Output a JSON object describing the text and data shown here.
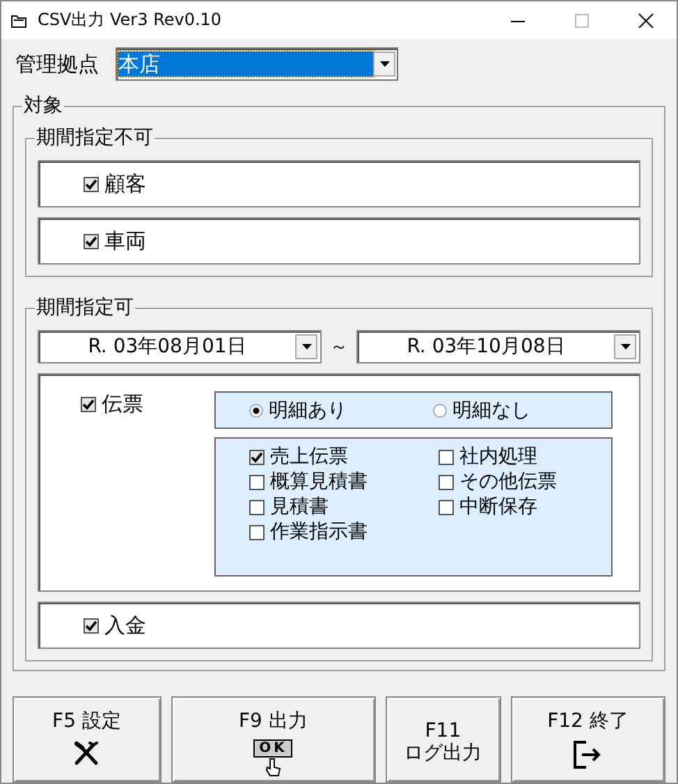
{
  "window": {
    "title": "CSV出力 Ver3 Rev0.10"
  },
  "base": {
    "label": "管理拠点",
    "value": "本店"
  },
  "target": {
    "title": "対象",
    "no_period": {
      "title": "期間指定不可",
      "items": [
        {
          "label": "顧客",
          "checked": true
        },
        {
          "label": "車両",
          "checked": true
        }
      ]
    },
    "period": {
      "title": "期間指定可",
      "from": "R. 03年08月01日",
      "separator": "～",
      "to": "R. 03年10月08日",
      "slip": {
        "label": "伝票",
        "checked": true,
        "detail_options": [
          {
            "label": "明細あり",
            "selected": true
          },
          {
            "label": "明細なし",
            "selected": false
          }
        ],
        "types": [
          {
            "label": "売上伝票",
            "checked": true
          },
          {
            "label": "社内処理",
            "checked": false
          },
          {
            "label": "概算見積書",
            "checked": false
          },
          {
            "label": "その他伝票",
            "checked": false
          },
          {
            "label": "見積書",
            "checked": false
          },
          {
            "label": "中断保存",
            "checked": false
          },
          {
            "label": "作業指示書",
            "checked": false
          }
        ]
      },
      "payment": {
        "label": "入金",
        "checked": true
      }
    }
  },
  "buttons": [
    {
      "key": "F5",
      "label": "設定",
      "kind": "settings"
    },
    {
      "key": "F9",
      "label": "出力",
      "kind": "ok",
      "badge": "OK"
    },
    {
      "key": "F11",
      "label": "ログ出力",
      "kind": "text"
    },
    {
      "key": "F12",
      "label": "終了",
      "kind": "exit"
    }
  ]
}
